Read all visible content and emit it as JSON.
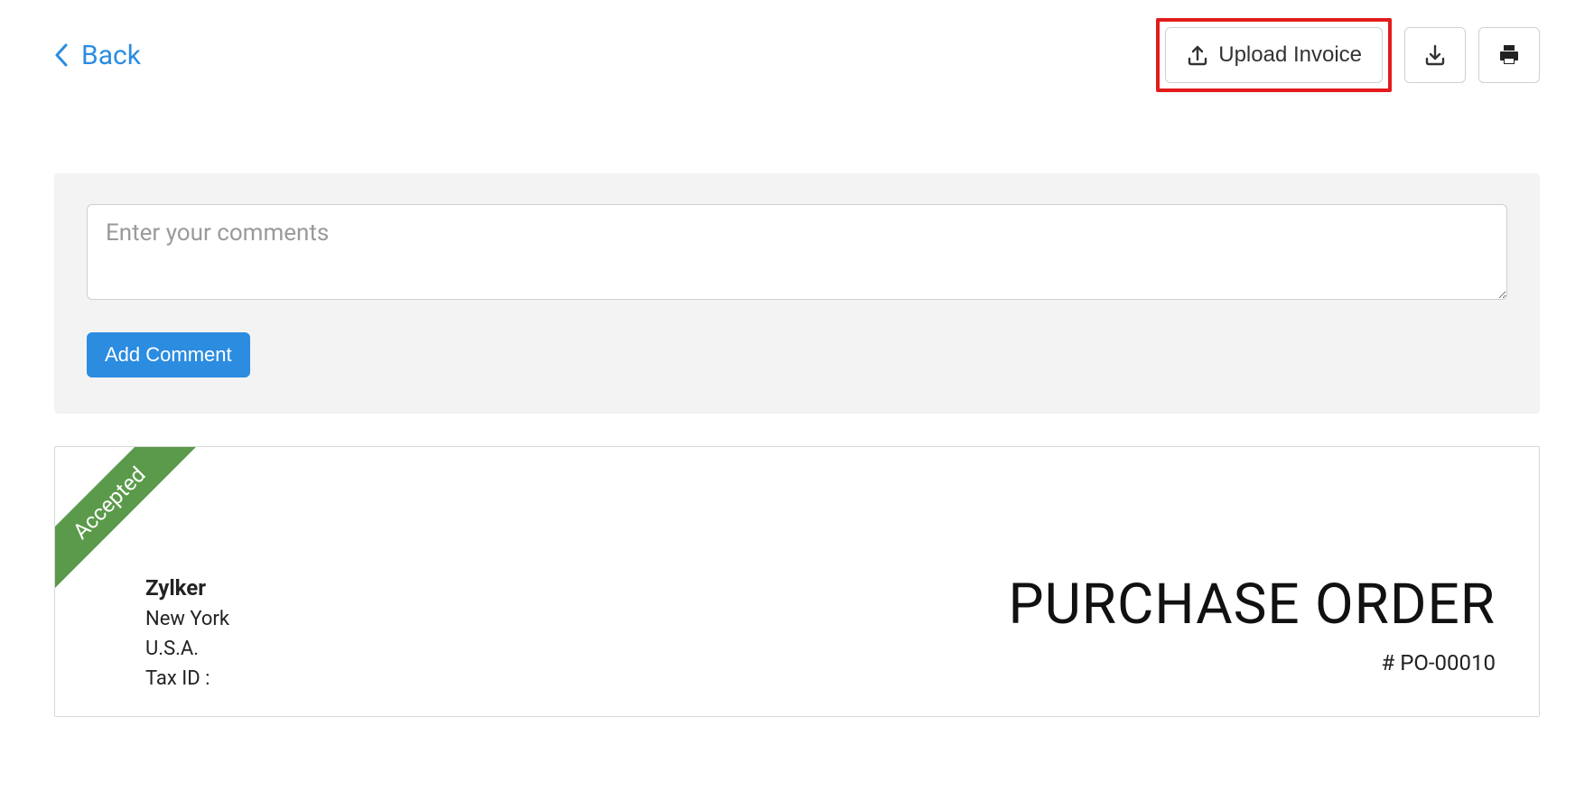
{
  "nav": {
    "back_label": "Back"
  },
  "actions": {
    "upload_label": "Upload Invoice"
  },
  "comments": {
    "placeholder": "Enter your comments",
    "add_label": "Add Comment"
  },
  "document": {
    "status": "Accepted",
    "org": {
      "name": "Zylker",
      "city": "New York",
      "country": "U.S.A.",
      "tax_label": "Tax ID :",
      "tax_value": ""
    },
    "title": "PURCHASE ORDER",
    "number": "# PO-00010"
  }
}
